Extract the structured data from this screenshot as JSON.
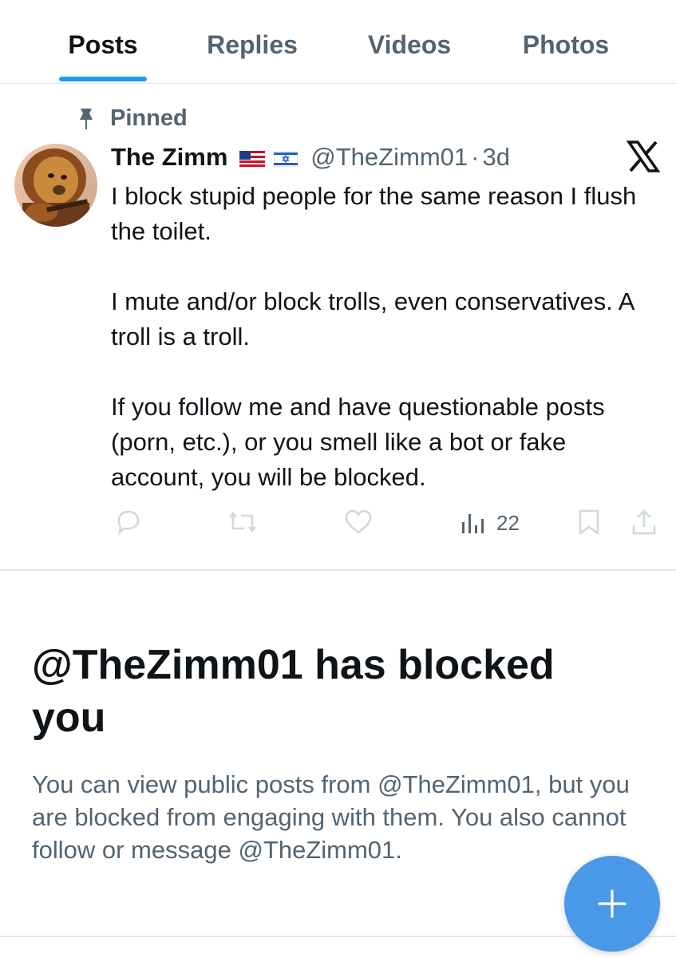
{
  "tabs": [
    {
      "label": "Posts",
      "active": true
    },
    {
      "label": "Replies",
      "active": false
    },
    {
      "label": "Videos",
      "active": false
    },
    {
      "label": "Photos",
      "active": false
    }
  ],
  "pinned_label": "Pinned",
  "post": {
    "display_name": "The Zimm",
    "flags": [
      "us-flag-icon",
      "israel-flag-icon"
    ],
    "handle": "@TheZimm01",
    "separator": "·",
    "time": "3d",
    "paragraphs": [
      "I block stupid people for the same reason I flush the toilet.",
      "I mute and/or block trolls, even conservatives.  A troll is a troll.",
      "If you follow me and have questionable posts (porn, etc.), or you smell like a bot or fake account, you will be blocked."
    ],
    "views": "22",
    "action_icons": [
      "reply-icon",
      "repost-icon",
      "like-icon",
      "views-icon",
      "bookmark-icon",
      "share-icon"
    ]
  },
  "blocked": {
    "title": "@TheZimm01 has blocked you",
    "description": "You can view public posts from @TheZimm01, but you are blocked from engaging with them. You also cannot follow or message @TheZimm01."
  },
  "colors": {
    "accent": "#1d9bf0",
    "fab": "#4a99e9",
    "secondary_text": "#536471",
    "primary_text": "#0f1419"
  }
}
